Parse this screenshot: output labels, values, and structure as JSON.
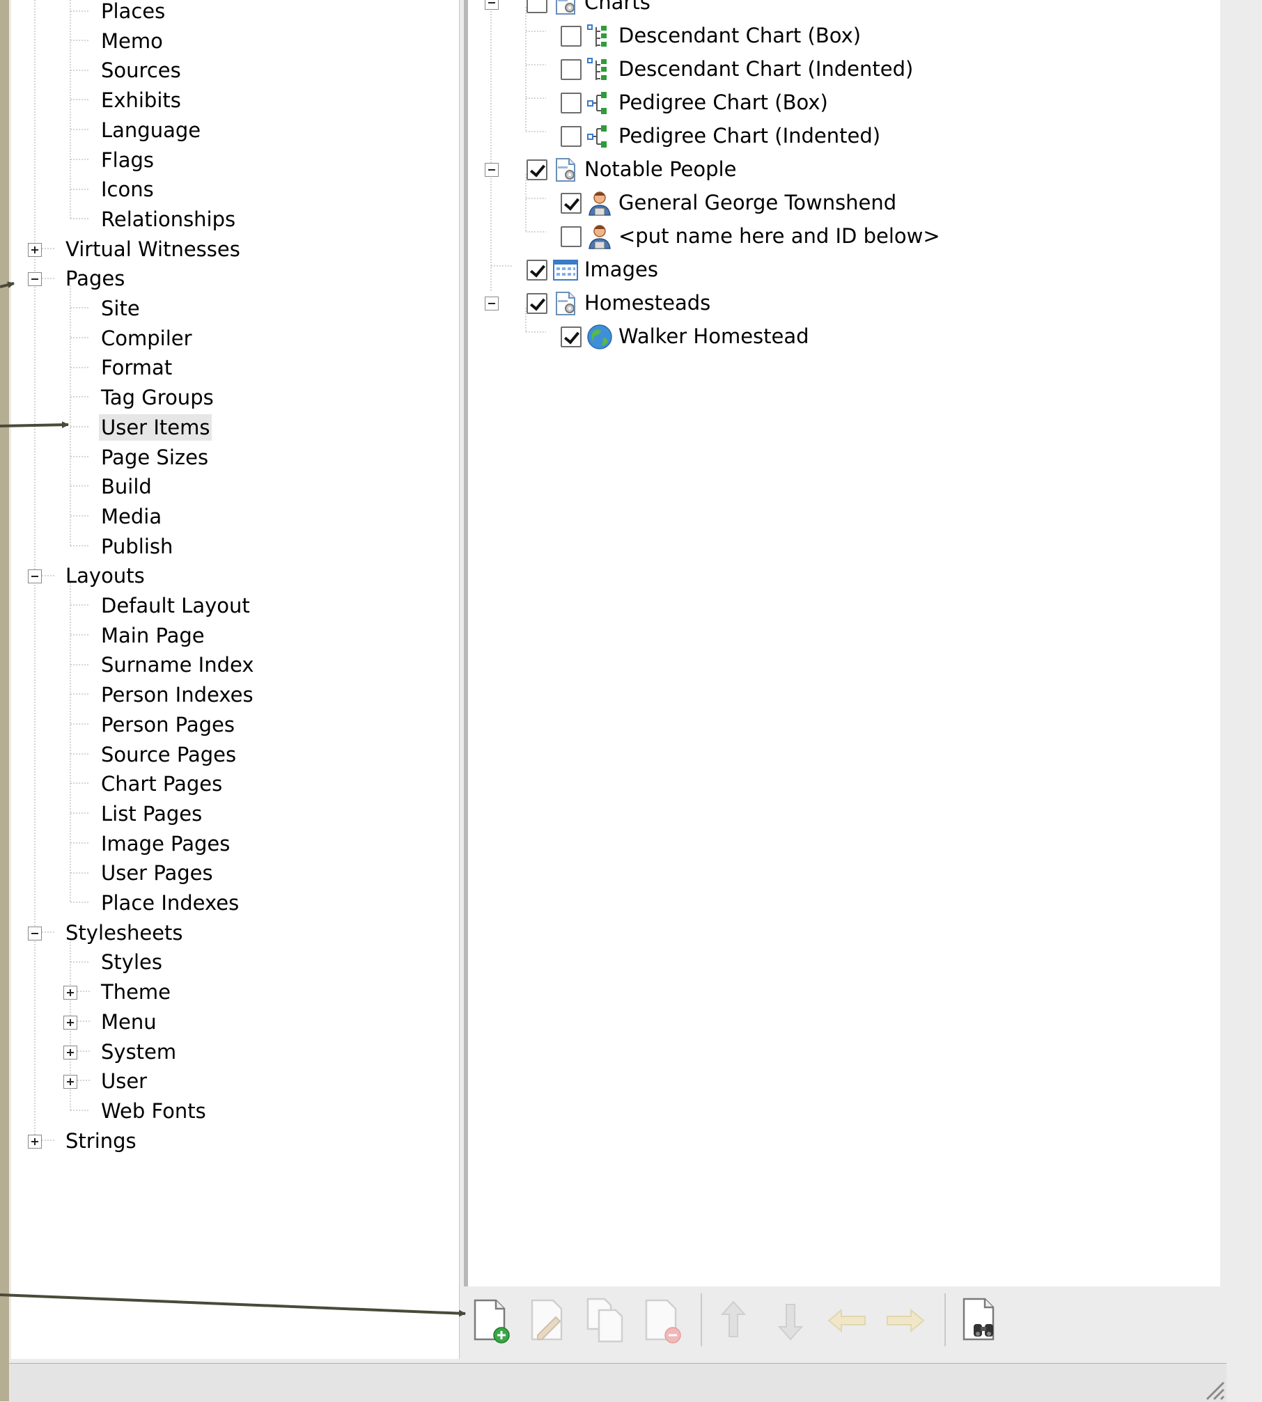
{
  "left_tree": {
    "items": [
      {
        "label": "Places"
      },
      {
        "label": "Memo"
      },
      {
        "label": "Sources"
      },
      {
        "label": "Exhibits"
      },
      {
        "label": "Language"
      },
      {
        "label": "Flags"
      },
      {
        "label": "Icons"
      },
      {
        "label": "Relationships"
      },
      {
        "label": "Virtual Witnesses",
        "toggle": "plus"
      },
      {
        "label": "Pages",
        "toggle": "minus"
      },
      {
        "label": "Site"
      },
      {
        "label": "Compiler"
      },
      {
        "label": "Format"
      },
      {
        "label": "Tag Groups"
      },
      {
        "label": "User Items",
        "selected": true
      },
      {
        "label": "Page Sizes"
      },
      {
        "label": "Build"
      },
      {
        "label": "Media"
      },
      {
        "label": "Publish"
      },
      {
        "label": "Layouts",
        "toggle": "minus"
      },
      {
        "label": "Default Layout"
      },
      {
        "label": "Main Page"
      },
      {
        "label": "Surname Index"
      },
      {
        "label": "Person Indexes"
      },
      {
        "label": "Person Pages"
      },
      {
        "label": "Source Pages"
      },
      {
        "label": "Chart Pages"
      },
      {
        "label": "List Pages"
      },
      {
        "label": "Image Pages"
      },
      {
        "label": "User Pages"
      },
      {
        "label": "Place Indexes"
      },
      {
        "label": "Stylesheets",
        "toggle": "minus"
      },
      {
        "label": "Styles"
      },
      {
        "label": "Theme",
        "toggle": "plus"
      },
      {
        "label": "Menu",
        "toggle": "plus"
      },
      {
        "label": "System",
        "toggle": "plus"
      },
      {
        "label": "User",
        "toggle": "plus"
      },
      {
        "label": "Web Fonts"
      },
      {
        "label": "Strings",
        "toggle": "plus"
      }
    ]
  },
  "right_tree": {
    "items": [
      {
        "label": "Charts",
        "checked": false,
        "icon": "folder-gear-icon",
        "toggle": "minus"
      },
      {
        "label": "Descendant Chart (Box)",
        "checked": false,
        "icon": "descendant-chart-icon"
      },
      {
        "label": "Descendant Chart (Indented)",
        "checked": false,
        "icon": "descendant-chart-icon"
      },
      {
        "label": "Pedigree Chart (Box)",
        "checked": false,
        "icon": "pedigree-chart-icon"
      },
      {
        "label": "Pedigree Chart (Indented)",
        "checked": false,
        "icon": "pedigree-chart-icon"
      },
      {
        "label": "Notable People",
        "checked": true,
        "icon": "folder-gear-icon",
        "toggle": "minus"
      },
      {
        "label": "General George Townshend",
        "checked": true,
        "icon": "person-icon"
      },
      {
        "label": "<put name here and ID below>",
        "checked": false,
        "icon": "person-icon"
      },
      {
        "label": "Images",
        "checked": true,
        "icon": "image-grid-icon"
      },
      {
        "label": "Homesteads",
        "checked": true,
        "icon": "folder-gear-icon",
        "toggle": "minus"
      },
      {
        "label": "Walker Homestead",
        "checked": true,
        "icon": "globe-icon"
      }
    ]
  },
  "toolbar": {
    "buttons": [
      {
        "icon": "new-item-icon",
        "enabled": true
      },
      {
        "icon": "edit-item-icon",
        "enabled": false
      },
      {
        "icon": "copy-item-icon",
        "enabled": false
      },
      {
        "icon": "delete-item-icon",
        "enabled": false
      },
      {
        "icon": "move-up-icon",
        "enabled": false
      },
      {
        "icon": "move-down-icon",
        "enabled": false
      },
      {
        "icon": "move-left-icon",
        "enabled": false
      },
      {
        "icon": "move-right-icon",
        "enabled": false
      },
      {
        "icon": "find-item-icon",
        "enabled": true
      }
    ]
  },
  "colors": {
    "annotation_arrow": "#4a4a3a",
    "selected_bg": "#e6e6e6"
  }
}
